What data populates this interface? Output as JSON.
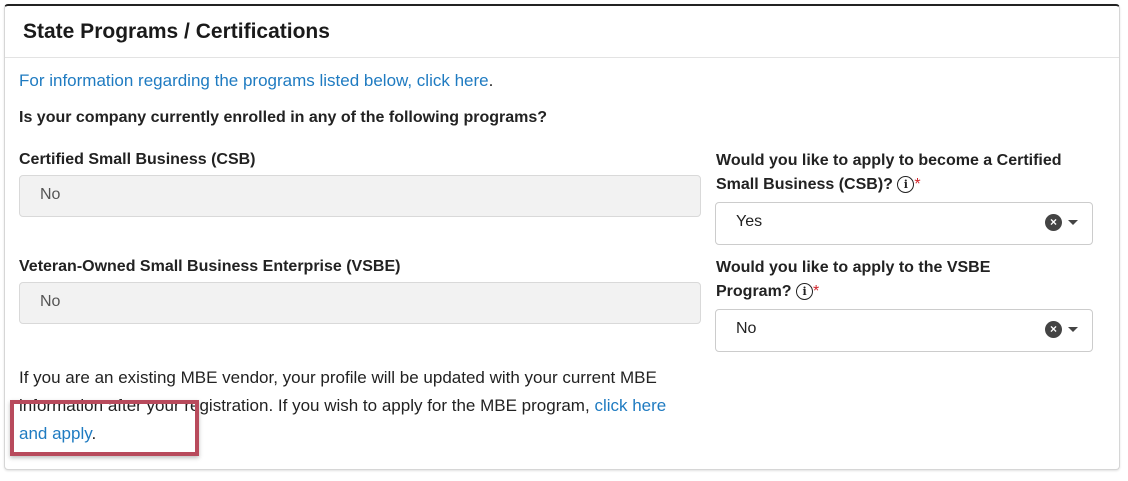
{
  "panel": {
    "title": "State Programs / Certifications"
  },
  "info": {
    "link_text": "For information regarding the programs listed below, click here",
    "suffix": "."
  },
  "question": "Is your company currently enrolled in any of the following programs?",
  "csb": {
    "label": "Certified Small Business (CSB)",
    "value": "No",
    "apply_question": "Would you like to apply to become a Certified Small Business (CSB)?",
    "apply_value": "Yes",
    "required_mark": "*"
  },
  "vsbe": {
    "label": "Veteran-Owned Small Business Enterprise (VSBE)",
    "value": "No",
    "apply_question": "Would you like to apply to the VSBE Program?",
    "apply_value": "No",
    "required_mark": "*"
  },
  "mbe": {
    "text": "If you are an existing MBE vendor, your profile will be updated with your current MBE information after your registration. If you wish to apply for the MBE program,",
    "link_text": "click here and apply",
    "suffix": "."
  },
  "icons": {
    "info": "info-circle-icon",
    "clear": "clear-x-icon",
    "caret": "caret-down-icon"
  },
  "colors": {
    "link": "#1f7bc1",
    "required": "#d0242b",
    "highlight": "#b84a5c"
  }
}
